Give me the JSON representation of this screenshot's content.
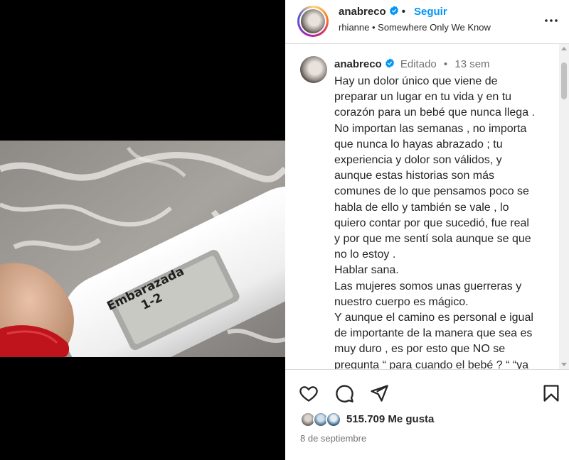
{
  "post": {
    "username": "anabreco",
    "follow_label": "Seguir",
    "audio": "rhianne • Somewhere Only We Know",
    "edited_label": "Editado",
    "age": "13 sem",
    "caption": "Hay un dolor único que viene de\npreparar un lugar en tu vida y en tu\ncorazón para un bebé que nunca llega .\nNo importan las semanas , no importa\nque nunca lo hayas abrazado ; tu\nexperiencia y dolor son válidos, y\naunque estas historias son más\ncomunes de lo que pensamos poco se\nhabla de ello y también se vale , lo\nquiero contar por que sucedió, fue real\ny por que me sentí sola aunque se que\nno lo estoy .\nHablar sana.\nLas mujeres somos unas guerreras y\nnuestro cuerpo es mágico.\nY aunque el camino es personal e igual\nde importante de la manera que sea es\nmuy duro , es por esto que NO se\npregunta “ para cuando el bebé ? “ “ya",
    "likes": "515.709 Me gusta",
    "date": "8 de septiembre"
  },
  "media": {
    "display_line1": "Embarazada",
    "display_line2": "1-2"
  },
  "icons": {
    "verified": "verified-badge-icon",
    "more": "more-options-icon",
    "like": "heart-icon",
    "comment": "comment-icon",
    "share": "share-icon",
    "save": "bookmark-icon"
  },
  "colors": {
    "accent": "#0095f6",
    "verified": "#0095f6",
    "nail": "#c0141c"
  }
}
